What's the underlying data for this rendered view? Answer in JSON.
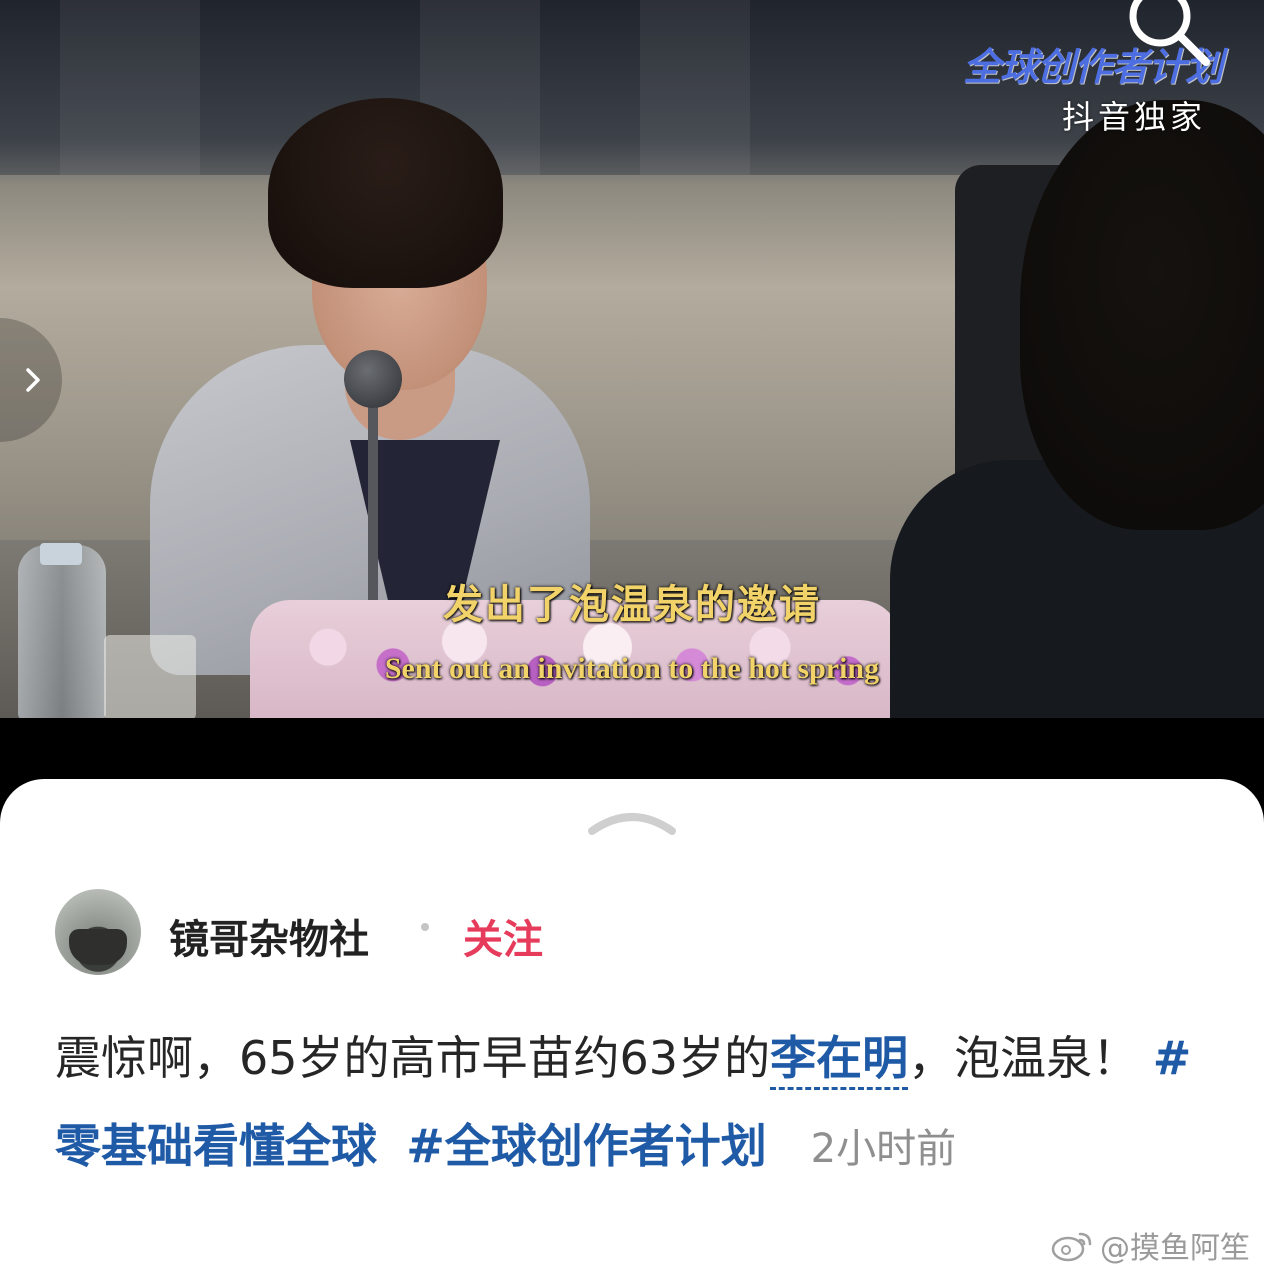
{
  "video": {
    "brand_text": "全球创作者计划",
    "brand_sub": "抖音独家",
    "subtitle_cn": "发出了泡温泉的邀请",
    "subtitle_en": "Sent out an invitation to the hot spring",
    "icons": {
      "search": "search-icon",
      "next": "chevron-right-icon"
    }
  },
  "sheet": {
    "handle_icon": "chevron-up-icon",
    "author": {
      "name": "镜哥杂物社",
      "follow_label": "关注",
      "follow_color": "#e63b5b"
    },
    "post": {
      "text_before": "震惊啊，65岁的高市早苗约63岁的",
      "mention": "李在明",
      "text_after": "，泡温泉！ ",
      "hashtags": [
        "#零基础看懂全球",
        "#全球创作者计划"
      ],
      "time": "2小时前",
      "link_color": "#1f5aa6"
    },
    "watermark": "@摸鱼阿笙"
  }
}
